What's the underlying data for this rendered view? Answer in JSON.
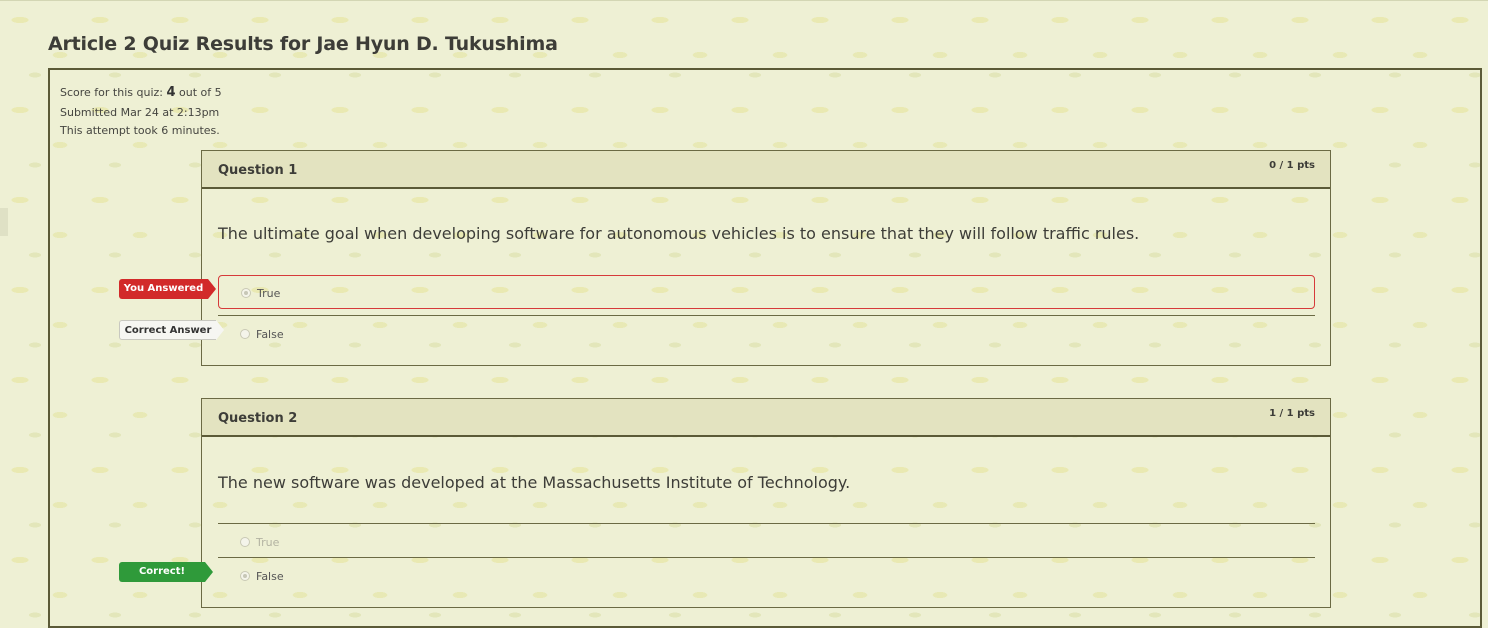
{
  "page": {
    "title": "Article 2 Quiz Results for Jae Hyun D. Tukushima"
  },
  "summary": {
    "score_prefix": "Score for this quiz: ",
    "score_value": "4",
    "score_suffix": " out of 5",
    "submitted": "Submitted Mar 24 at 2:13pm",
    "duration": "This attempt took 6 minutes."
  },
  "questions": [
    {
      "title": "Question 1",
      "points": "0 / 1 pts",
      "text": "The ultimate goal when developing software for autonomous vehicles is to ensure that they will follow traffic rules.",
      "answers": [
        {
          "label": "True",
          "selected": true,
          "flag": "You Answered"
        },
        {
          "label": "False",
          "selected": false,
          "flag": "Correct Answer"
        }
      ]
    },
    {
      "title": "Question 2",
      "points": "1 / 1 pts",
      "text": "The new software was developed at the Massachusetts Institute of Technology.",
      "answers": [
        {
          "label": "True",
          "selected": false,
          "flag": ""
        },
        {
          "label": "False",
          "selected": true,
          "flag": "Correct!"
        }
      ]
    }
  ],
  "colors": {
    "background": "#eef0d4",
    "border": "#5b5a37",
    "header": "#e3e3c0",
    "wrong": "#d22a2a",
    "correct": "#2f9a3a"
  }
}
